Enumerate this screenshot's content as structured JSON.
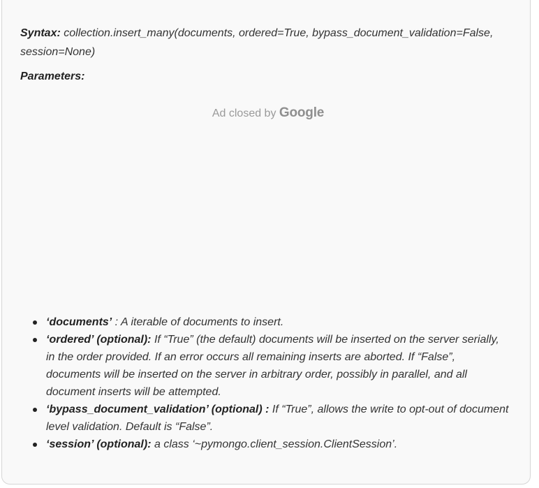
{
  "syntax": {
    "label": "Syntax:",
    "text": " collection.insert_many(documents, ordered=True, bypass_document_validation=False, session=None)"
  },
  "parameters_heading": "Parameters:",
  "ad": {
    "closed_text": "Ad closed by ",
    "brand": "Google"
  },
  "params": [
    {
      "name": "‘documents’",
      "desc": " : A iterable of documents to insert."
    },
    {
      "name": "‘ordered’ (optional):",
      "desc": " If “True” (the default) documents will be inserted on the server serially, in the order provided. If an error occurs all remaining inserts are aborted. If “False”, documents will be inserted on the server in arbitrary order, possibly in parallel, and all document inserts will be attempted."
    },
    {
      "name": "‘bypass_document_validation’ (optional) :",
      "desc": " If “True”, allows the write to opt-out of document level validation. Default is “False”."
    },
    {
      "name": "‘session’ (optional):",
      "desc": " a class ‘~pymongo.client_session.ClientSession’."
    }
  ]
}
